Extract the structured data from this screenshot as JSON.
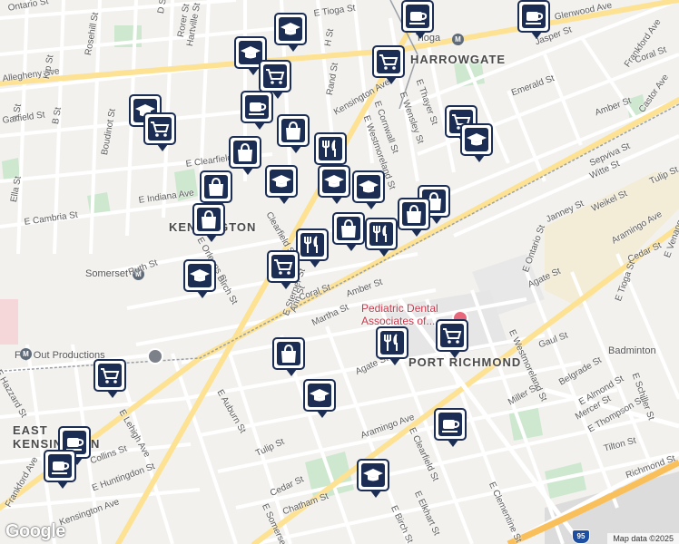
{
  "neighborhoods": [
    "HARROWGATE",
    "KENSINGTON",
    "PORT RICHMOND",
    "EAST KENSINGTON"
  ],
  "places": {
    "pediatric_dental": "Pediatric Dental Associates of...",
    "flip_out": "Flip Out Productions",
    "badminton": "Badminton"
  },
  "stations": [
    "Tioga",
    "Somerset"
  ],
  "streets": [
    "Ontario St",
    "E Tioga St",
    "Glenwood Ave",
    "Frankford Ave",
    "Jasper St",
    "Coral St",
    "Castor Ave",
    "Allegheny Ave",
    "E Allegheny Ave",
    "B St",
    "A St",
    "Kip St",
    "Rosehill St",
    "Hartville St",
    "Rorer St",
    "D St",
    "H St",
    "Rand St",
    "Kensington Ave",
    "E Thayer St",
    "E Wensley St",
    "E Cornwall St",
    "E Westmoreland St",
    "Emerald St",
    "Amber St",
    "Garfield St",
    "Boudinot St",
    "E Clearfield St",
    "Clearfield St",
    "E Indiana Ave",
    "E Cambria St",
    "Ella St",
    "Sepviva St",
    "Witte St",
    "Weikel St",
    "Tulip St",
    "Janney St",
    "E Ontario St",
    "Aramingo Ave",
    "E Venango St",
    "Cedar St",
    "Agate St",
    "E Tioga St",
    "Ruth St",
    "E Orleans St",
    "Birch St",
    "E Sterner St",
    "Ann St",
    "Martha St",
    "Gaul St",
    "Belgrade St",
    "E Almond St",
    "Miller St",
    "Mercer St",
    "E Thompson St",
    "E Schiller St",
    "Tilton St",
    "Richmond St",
    "E Hazzard St",
    "E Lehigh Ave",
    "E Auburn St",
    "Collins St",
    "E Huntingdon St",
    "Chatham St",
    "E Clearfield St",
    "E Elkhart St",
    "E Clementine St",
    "E Somerset St",
    "E Birch St",
    "E Westmoreland St",
    "Kensington Ave",
    "E Birch"
  ],
  "footer": {
    "map_data": "Map data ©2025"
  },
  "brand": "Google",
  "highway": "95"
}
